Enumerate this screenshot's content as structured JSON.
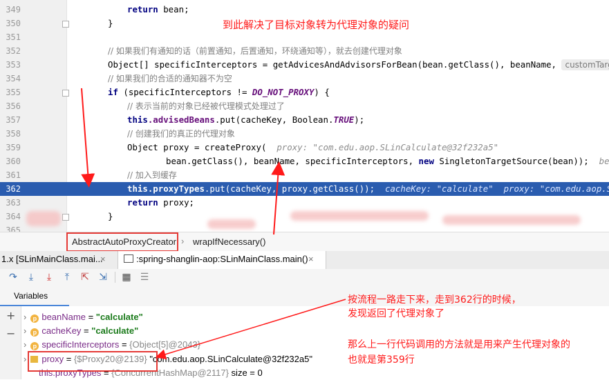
{
  "editor": {
    "lines": [
      {
        "num": "349",
        "text": "return bean;"
      },
      {
        "num": "350",
        "text": "}"
      },
      {
        "num": "351",
        "text": ""
      },
      {
        "num": "352",
        "text": "// 如果我们有通知的话（前置通知，后置通知，环绕通知等），就去创建代理对象"
      },
      {
        "num": "353",
        "pre": "Object[] specificInterceptors = getAdvicesAndAdvisorsForBean(bean.getClass(), beanName, ",
        "inlay": "customTargetSou"
      },
      {
        "num": "354",
        "text": "// 如果我们的合适的通知器不为空"
      },
      {
        "num": "355",
        "kw": "if",
        "pre": " (specificInterceptors != ",
        "const": "DO_NOT_PROXY",
        "post": ") {"
      },
      {
        "num": "356",
        "text": "// 表示当前的对象已经被代理模式处理过了"
      },
      {
        "num": "357",
        "kw": "this",
        "fld": ".advisedBeans",
        "post": ".put(cacheKey, Boolean.",
        "const": "TRUE",
        "end": ");"
      },
      {
        "num": "358",
        "text": "// 创建我们的真正的代理对象"
      },
      {
        "num": "359",
        "pre": "Object proxy = createProxy(  ",
        "hint": "proxy: \"com.edu.aop.SLinCalculate@32f232a5\""
      },
      {
        "num": "360",
        "pre": "bean.getClass(), beanName, specificInterceptors, ",
        "kw": "new",
        "post": " SingletonTargetSource(bean));  ",
        "hint": "bean: SL"
      },
      {
        "num": "361",
        "text": "// 加入到缓存"
      },
      {
        "num": "362",
        "kw": "this",
        "fld": ".proxyTypes",
        "post": ".put(cacheKey, proxy.getClass());  ",
        "hint": "cacheKey: \"calculate\"  proxy: \"com.edu.aop.SLinCal"
      },
      {
        "num": "363",
        "kw": "return",
        "post": " proxy;"
      },
      {
        "num": "364",
        "text": "}"
      },
      {
        "num": "365",
        "text": ""
      }
    ],
    "annotation_top": "到此解决了目标对象转为代理对象的疑问"
  },
  "breadcrumbs": {
    "class_name": "AbstractAutoProxyCreator",
    "separator": "›",
    "method_name": "wrapIfNecessary()"
  },
  "tabs": [
    {
      "label": "1.x [SLinMainClass.mai...",
      "close": "×"
    },
    {
      "label": ":spring-shanglin-aop:SLinMainClass.main()",
      "close": "×"
    }
  ],
  "toolbar": {
    "icons": [
      "step-over-icon",
      "step-into-icon",
      "force-step-into-icon",
      "step-out-icon",
      "drop-frame-icon",
      "run-to-cursor-icon",
      "evaluate-icon",
      "trace-icon"
    ]
  },
  "variables": {
    "title": "Variables",
    "rows": [
      {
        "name": "beanName",
        "eq": " = ",
        "value": "\"calculate\"",
        "type": "str"
      },
      {
        "name": "cacheKey",
        "eq": " = ",
        "value": "\"calculate\"",
        "type": "str"
      },
      {
        "name": "specificInterceptors",
        "eq": " = ",
        "value": "{Object[5]@2043}",
        "type": "gray"
      },
      {
        "name": "proxy",
        "eq": " = ",
        "value": "{$Proxy20@2139}",
        "extra": " \"com.edu.aop.SLinCalculate@32f232a5\"",
        "type": "proxy"
      },
      {
        "name": "this.proxyTypes",
        "eq": " = ",
        "value": "{ConcurrentHashMap@2117}",
        "extra": "  size = 0",
        "type": "gray"
      }
    ]
  },
  "annotations": {
    "right_1": "按流程一路走下来，走到362行的时候，",
    "right_2": "发现返回了代理对象了",
    "right_3": "那么上一行代码调用的方法就是用来产生代理对象的",
    "right_4": "也就是第359行"
  },
  "colors": {
    "selection": "#2a5caf",
    "annotation": "#ff1a1a"
  }
}
